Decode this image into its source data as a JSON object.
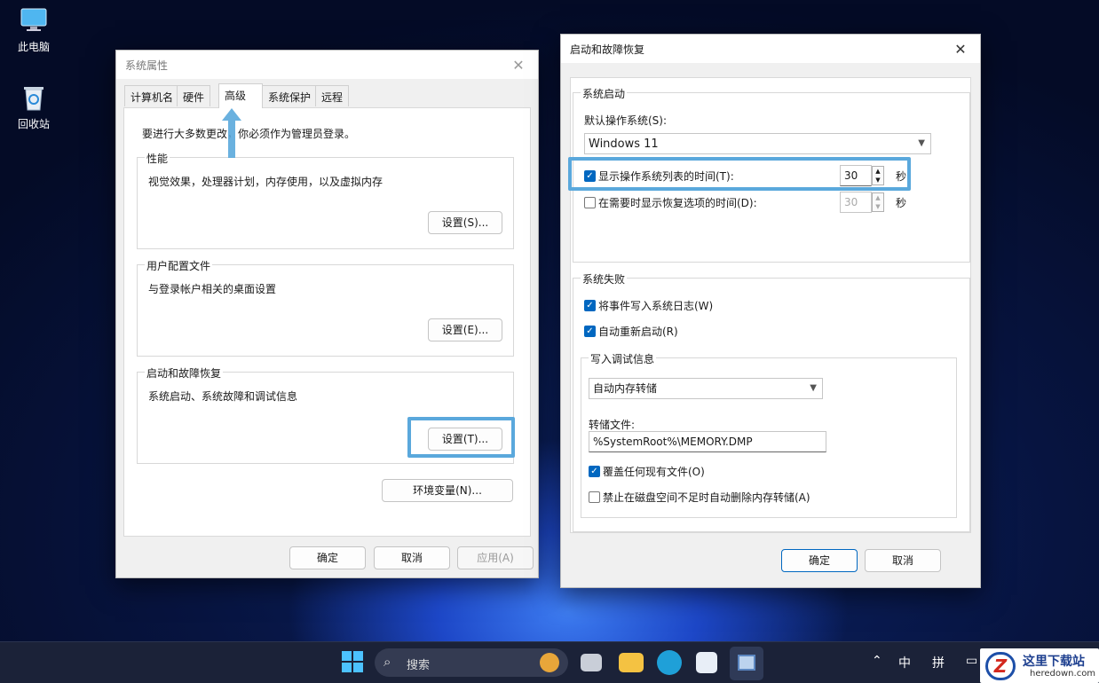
{
  "desktop": {
    "icons": [
      {
        "label": "此电脑",
        "icon": "computer-icon"
      },
      {
        "label": "回收站",
        "icon": "recycle-bin-icon"
      }
    ]
  },
  "sysprop": {
    "title": "系统属性",
    "tabs": [
      "计算机名",
      "硬件",
      "高级",
      "系统保护",
      "远程"
    ],
    "admin_note": "要进行大多数更改，你必须作为管理员登录。",
    "groups": [
      {
        "label": "性能",
        "desc": "视觉效果，处理器计划，内存使用，以及虚拟内存",
        "button": "设置(S)..."
      },
      {
        "label": "用户配置文件",
        "desc": "与登录帐户相关的桌面设置",
        "button": "设置(E)..."
      },
      {
        "label": "启动和故障恢复",
        "desc": "系统启动、系统故障和调试信息",
        "button": "设置(T)..."
      }
    ],
    "env_button": "环境变量(N)...",
    "ok": "确定",
    "cancel": "取消",
    "apply": "应用(A)"
  },
  "startup": {
    "title": "启动和故障恢复",
    "system_startup": {
      "label": "系统启动",
      "default_os_label": "默认操作系统(S):",
      "default_os_value": "Windows 11",
      "show_list_label": "显示操作系统列表的时间(T):",
      "show_list_checked": true,
      "show_list_value": "30",
      "show_recovery_label": "在需要时显示恢复选项的时间(D):",
      "show_recovery_checked": false,
      "show_recovery_value": "30",
      "seconds": "秒"
    },
    "system_failure": {
      "label": "系统失败",
      "write_event": "将事件写入系统日志(W)",
      "write_event_checked": true,
      "auto_restart": "自动重新启动(R)",
      "auto_restart_checked": true,
      "debug_label": "写入调试信息",
      "debug_select": "自动内存转储",
      "dump_file_label": "转储文件:",
      "dump_file_value": "%SystemRoot%\\MEMORY.DMP",
      "overwrite": "覆盖任何现有文件(O)",
      "overwrite_checked": true,
      "disable_auto_delete": "禁止在磁盘空间不足时自动删除内存转储(A)",
      "disable_auto_delete_checked": false
    },
    "ok": "确定",
    "cancel": "取消"
  },
  "taskbar": {
    "search_placeholder": "搜索",
    "tray_ime1": "中",
    "tray_ime2": "拼",
    "watermark_title": "这里下载站",
    "watermark_url": "heredown.com",
    "colors": {
      "accent": "#0067c0",
      "highlight": "#5aa8dc"
    }
  }
}
